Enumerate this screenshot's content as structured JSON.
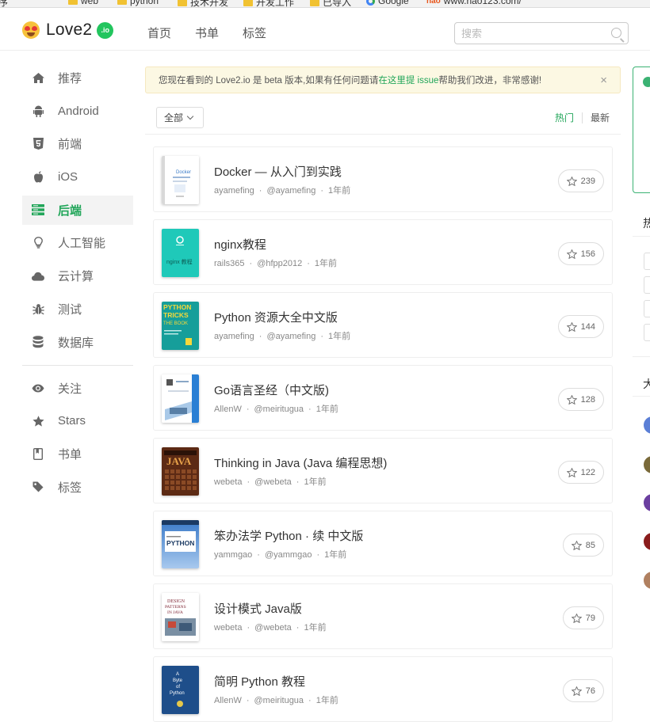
{
  "bookmarks": [
    {
      "label": "程序",
      "icon": "folder-icon"
    },
    {
      "label": "web",
      "icon": "folder-icon"
    },
    {
      "label": "python",
      "icon": "folder-icon"
    },
    {
      "label": "技术开发",
      "icon": "folder-icon"
    },
    {
      "label": "开发工作",
      "icon": "folder-icon"
    },
    {
      "label": "已导入",
      "icon": "folder-icon"
    },
    {
      "label": "Google",
      "icon": "google-icon"
    },
    {
      "label": "www.hao123.com/",
      "icon": "hao123-icon"
    }
  ],
  "header": {
    "logo_text": "Love2",
    "logo_badge": ".io",
    "nav": [
      {
        "label": "首页"
      },
      {
        "label": "书单"
      },
      {
        "label": "标签"
      }
    ],
    "search_placeholder": "搜索"
  },
  "sidebar": {
    "primary": [
      {
        "label": "推荐",
        "icon": "home-icon",
        "active": false
      },
      {
        "label": "Android",
        "icon": "android-icon",
        "active": false
      },
      {
        "label": "前端",
        "icon": "html5-icon",
        "active": false
      },
      {
        "label": "iOS",
        "icon": "apple-icon",
        "active": false
      },
      {
        "label": "后端",
        "icon": "server-icon",
        "active": true
      },
      {
        "label": "人工智能",
        "icon": "lightbulb-icon",
        "active": false
      },
      {
        "label": "云计算",
        "icon": "cloud-icon",
        "active": false
      },
      {
        "label": "测试",
        "icon": "bug-icon",
        "active": false
      },
      {
        "label": "数据库",
        "icon": "database-icon",
        "active": false
      }
    ],
    "secondary": [
      {
        "label": "关注",
        "icon": "eye-icon"
      },
      {
        "label": "Stars",
        "icon": "star-icon"
      },
      {
        "label": "书单",
        "icon": "booklist-icon"
      },
      {
        "label": "标签",
        "icon": "tag-icon"
      }
    ]
  },
  "notice": {
    "text_before": "您现在看到的 Love2.io 是 beta 版本,如果有任何问题请",
    "link_text": "在这里提 issue",
    "text_after": " 帮助我们改进，非常感谢!",
    "close": "×"
  },
  "filter": {
    "select_value": "全部",
    "sort_hot": "热门",
    "sort_new": "最新"
  },
  "books": [
    {
      "title": "Docker — 从入门到实践",
      "author": "ayamefing",
      "handle": "@ayamefing",
      "time": "1年前",
      "stars": "239",
      "cover": "docker"
    },
    {
      "title": "nginx教程",
      "author": "rails365",
      "handle": "@hfpp2012",
      "time": "1年前",
      "stars": "156",
      "cover": "nginx"
    },
    {
      "title": "Python 资源大全中文版",
      "author": "ayamefing",
      "handle": "@ayamefing",
      "time": "1年前",
      "stars": "144",
      "cover": "python-tricks"
    },
    {
      "title": "Go语言圣经（中文版)",
      "author": "AllenW",
      "handle": "@meiritugua",
      "time": "1年前",
      "stars": "128",
      "cover": "go"
    },
    {
      "title": "Thinking in Java (Java 编程思想)",
      "author": "webeta",
      "handle": "@webeta",
      "time": "1年前",
      "stars": "122",
      "cover": "java"
    },
    {
      "title": "笨办法学 Python · 续 中文版",
      "author": "yammgao",
      "handle": "@yammgao",
      "time": "1年前",
      "stars": "85",
      "cover": "lp3thw"
    },
    {
      "title": "设计模式 Java版",
      "author": "webeta",
      "handle": "@webeta",
      "time": "1年前",
      "stars": "79",
      "cover": "design-patterns"
    },
    {
      "title": "简明 Python 教程",
      "author": "AllenW",
      "handle": "@meiritugua",
      "time": "1年前",
      "stars": "76",
      "cover": "byte-of-python"
    }
  ],
  "right_panel": {
    "title1": "热",
    "title2": "大"
  }
}
